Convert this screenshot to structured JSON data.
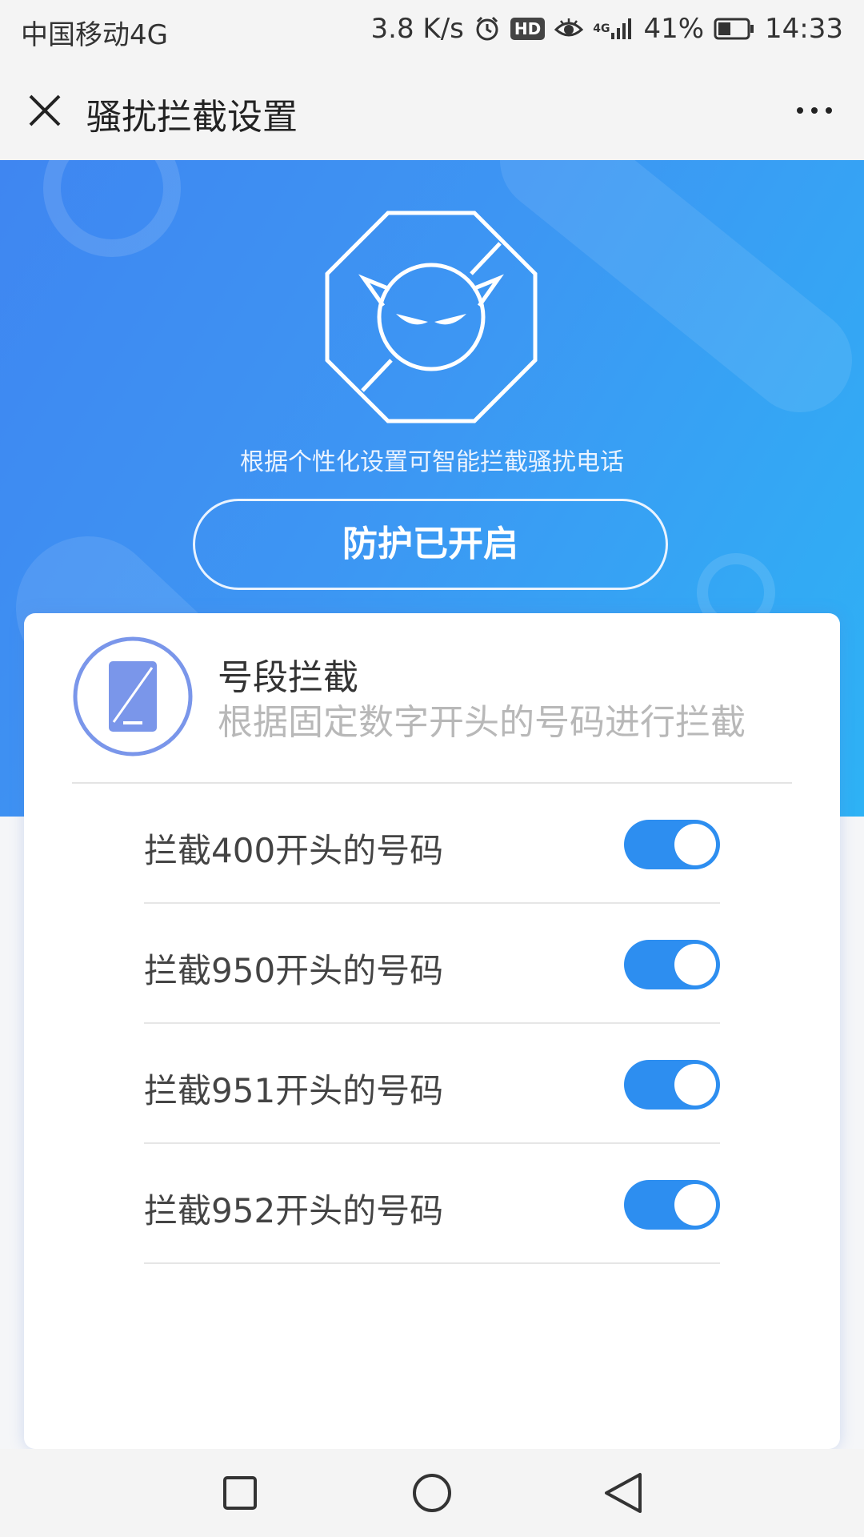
{
  "status_bar": {
    "carrier": "中国移动4G",
    "speed": "3.8 K/s",
    "hd_badge": "HD",
    "network": "4G",
    "battery": "41%",
    "time": "14:33",
    "icons": [
      "alarm-icon",
      "hd-icon",
      "eye-icon",
      "signal-icon",
      "battery-icon"
    ]
  },
  "header": {
    "title": "骚扰拦截设置",
    "close_icon": "close-icon",
    "more_icon": "more-icon"
  },
  "hero": {
    "subtitle": "根据个性化设置可智能拦截骚扰电话",
    "button_label": "防护已开启",
    "icon": "devil-shield-icon"
  },
  "card": {
    "title": "号段拦截",
    "description": "根据固定数字开头的号码进行拦截",
    "icon": "phone-icon",
    "rules": [
      {
        "label": "拦截400开头的号码",
        "enabled": true
      },
      {
        "label": "拦截950开头的号码",
        "enabled": true
      },
      {
        "label": "拦截951开头的号码",
        "enabled": true
      },
      {
        "label": "拦截952开头的号码",
        "enabled": true
      }
    ]
  },
  "nav": {
    "icons": [
      "recent-apps-icon",
      "home-icon",
      "back-icon"
    ]
  },
  "colors": {
    "accent": "#2d8ef0",
    "hero_start": "#3f86f1",
    "hero_end": "#2eb2f5"
  }
}
